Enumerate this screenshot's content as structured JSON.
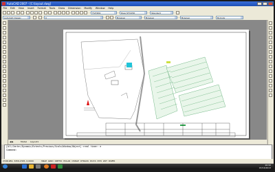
{
  "window": {
    "title": "AutoCAD 2007 - [C:\\layout.dwg]"
  },
  "menu": [
    "File",
    "Edit",
    "View",
    "Insert",
    "Format",
    "Tools",
    "Draw",
    "Dimension",
    "Modify",
    "Window",
    "Help"
  ],
  "toolbar": {
    "workspace": "AutoCAD Classic",
    "textstyle": "TS/TZ01",
    "dimstyle": "Diag STYLE/D",
    "tablestyle": "Standard",
    "layer": "0",
    "color": "ByLayer",
    "linetype": "ByLayer",
    "lineweight": "ByLayer",
    "plotstyle": "ByColor"
  },
  "layout_tabs": {
    "model": "Model",
    "layout1": "Layout1"
  },
  "command_line": {
    "line1": "[All/Center/Dynamic/Extents/Previous/Scale/Window/Object] <real time>: e",
    "line2": "Command:"
  },
  "status": {
    "coords": "2346.984, 3456.2345, 0.0000",
    "toggles": [
      "SNAP",
      "GRID",
      "ORTHO",
      "POLAR",
      "OSNAP",
      "OTRACK",
      "DUCS",
      "DYN",
      "LWT",
      "PAPER"
    ]
  },
  "taskbar": {
    "time": "10:32",
    "date": "07/13/2013"
  },
  "colors": {
    "title_bar": "#2458c4",
    "taskbar": "#1e1e1e",
    "paper": "#ffffff",
    "model_bg": "#888888",
    "site_green": "#1a8a3a",
    "pool_cyan": "#22c4d8"
  }
}
